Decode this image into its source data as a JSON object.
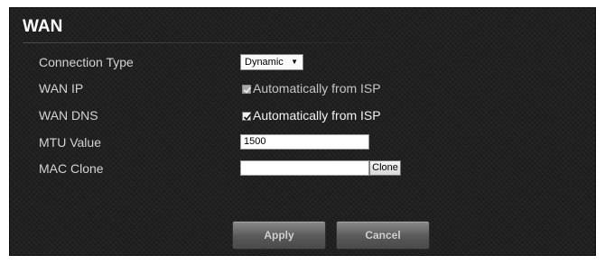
{
  "page": {
    "title": "WAN"
  },
  "fields": {
    "connection_type": {
      "label": "Connection Type",
      "value": "Dynamic"
    },
    "wan_ip": {
      "label": "WAN IP",
      "checkbox_label": "Automatically from ISP",
      "checked": true,
      "disabled": true
    },
    "wan_dns": {
      "label": "WAN DNS",
      "checkbox_label": "Automatically from ISP",
      "checked": true,
      "disabled": false
    },
    "mtu": {
      "label": "MTU Value",
      "value": "1500"
    },
    "mac_clone": {
      "label": "MAC Clone",
      "value": "",
      "button_label": "Clone"
    }
  },
  "actions": {
    "apply_label": "Apply",
    "cancel_label": "Cancel"
  }
}
